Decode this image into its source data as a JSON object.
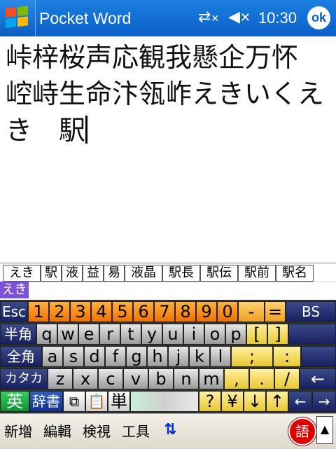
{
  "title_bar": {
    "app_title": "Pocket Word",
    "clock": "10:30",
    "ok_label": "ok",
    "icons": [
      "windows-start-icon",
      "network-icon",
      "speaker-icon"
    ]
  },
  "document": {
    "lines": [
      "峠梓桜声応観我懸企万怀",
      "崆峙生命汴瓴岞えきいくえ",
      "き　駅"
    ]
  },
  "candidates": [
    "えき",
    "駅",
    "液",
    "益",
    "易",
    "液晶",
    "駅長",
    "駅伝",
    "駅前",
    "駅名"
  ],
  "reading": "えき",
  "keyboard": {
    "row1": [
      "Esc",
      "1",
      "2",
      "3",
      "4",
      "5",
      "6",
      "7",
      "8",
      "9",
      "0",
      "-",
      "=",
      "BS"
    ],
    "row2": [
      "半角",
      "q",
      "w",
      "e",
      "r",
      "t",
      "y",
      "u",
      "i",
      "o",
      "p",
      "[",
      "]"
    ],
    "row3": [
      "全角",
      "a",
      "s",
      "d",
      "f",
      "g",
      "h",
      "j",
      "k",
      "l",
      ";",
      ":"
    ],
    "row4": [
      "カタカナ",
      "z",
      "x",
      "c",
      "v",
      "b",
      "n",
      "m",
      ",",
      ".",
      "/",
      "←"
    ],
    "row5": [
      "英",
      "辞書",
      "単",
      "?",
      "¥",
      "↓",
      "↑",
      "←",
      "→"
    ]
  },
  "menu": {
    "items": [
      "新増",
      "編輯",
      "検視",
      "工具"
    ],
    "ime_label": "語",
    "arrow_label": "▲"
  }
}
